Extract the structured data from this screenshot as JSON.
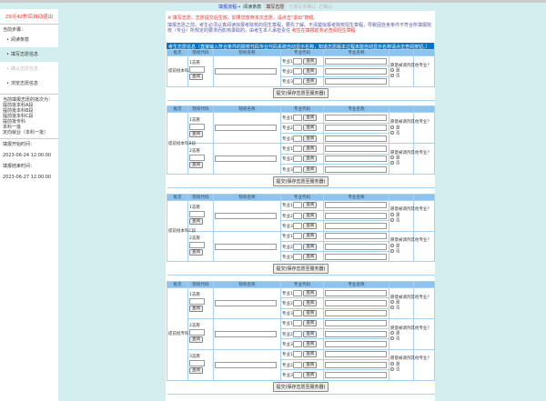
{
  "sidebar": {
    "timer": "29分42秒后自动退出",
    "steps_label": "当前步骤：",
    "steps": [
      {
        "label": "阅读条款",
        "state": "done"
      },
      {
        "label": "填写志愿信息",
        "state": "active"
      },
      {
        "label": "确认志愿信息",
        "state": "disabled"
      },
      {
        "label": "浏览志愿信息",
        "state": "done"
      }
    ],
    "batches_label": "当前填报志愿的批次为：",
    "batches": [
      "提前批本科A段",
      "提前批本科B段",
      "提前批本科C段",
      "提前批专科",
      "本科一批",
      "定向就业（本科一批）"
    ],
    "start_label": "填报开始时间：",
    "start_time": "2023-06-24 12:00:00",
    "end_label": "填报结束时间：",
    "end_time": "2023-06-27 12:00:00"
  },
  "nav": {
    "flow": "填报流程→",
    "items": [
      "阅读条款",
      "填写志愿",
      "已填写未确认",
      "已确认"
    ]
  },
  "notice": "※ 填写志愿，志愿提交后生效，如果您放弃本次志愿，请点击\"退出\"按钮。",
  "intro": "填报志愿之前，考生必须认真阅读拟报考院校的招生章程，要先了解。不清楚拟报考院校招生章程，导致因自身条件不符合所填报院校（专业）所规定的要求而影响录取的，由考生本人承担责任",
  "intro_red": "考生在填报前务必查阅招生章程",
  "info_bar": "考生志愿信息（直接输入符合条件的院校代码专业代码系统自动显示名称，知道志愿版本过程未能自动显示名称请点击查阅按钮。）",
  "headers": [
    "批次",
    "院校代码",
    "院校名称",
    "专业代码",
    "专业名称",
    "",
    ""
  ],
  "choice_suffix": "志愿",
  "major_prefix": "专业",
  "query_label": "查阅",
  "adjust_label": "愿意被调剂其他专业？",
  "yes": "是",
  "no": "否",
  "submit_label": "提交(保存志愿至服务器)",
  "sections": [
    {
      "batch": "提前批本科A段",
      "choices": [
        "1志愿"
      ]
    },
    {
      "batch": "提前批本科B段",
      "choices": [
        "1志愿",
        "2志愿"
      ]
    },
    {
      "batch": "提前批本科C段",
      "choices": [
        "1志愿",
        "2志愿"
      ]
    },
    {
      "batch": "提前批专科",
      "choices": [
        "1志愿",
        "2志愿",
        "3志愿"
      ]
    }
  ]
}
